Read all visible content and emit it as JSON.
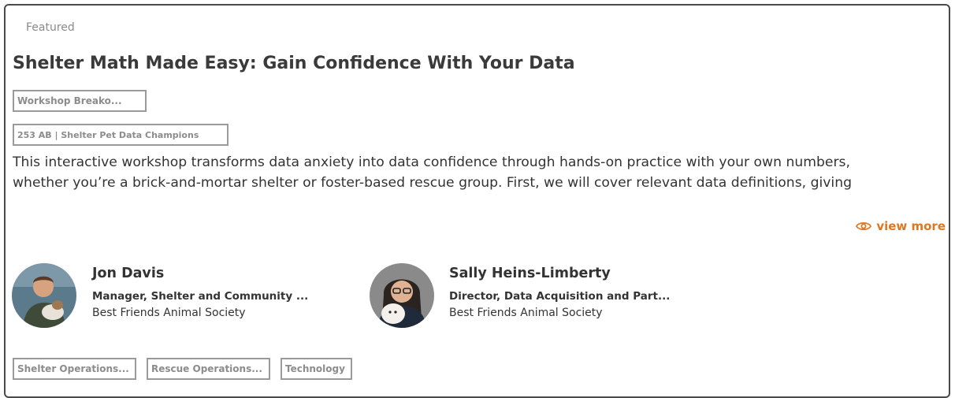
{
  "session": {
    "featured_label": "Featured",
    "title": "Shelter Math Made Easy: Gain Confidence With Your Data",
    "type_tag": "Workshop Breako...",
    "room_tag": "253 AB | Shelter Pet Data Champions",
    "description_lines": [
      "This interactive workshop transforms data anxiety into data confidence through hands-on practice with your own numbers,",
      "whether you’re a brick-and-mortar shelter or foster-based rescue group. First, we will cover relevant data definitions, giving"
    ],
    "view_more_label": "view more"
  },
  "speakers": [
    {
      "name": "Jon Davis",
      "role": "Manager, Shelter and Community ...",
      "organization": "Best Friends Animal Society"
    },
    {
      "name": "Sally Heins-Limberty",
      "role": "Director, Data Acquisition and Part...",
      "organization": "Best Friends Animal Society"
    }
  ],
  "tracks": [
    "Shelter Operations...",
    "Rescue Operations...",
    "Technology"
  ],
  "colors": {
    "accent": "#e07620",
    "border": "#4a4a4a",
    "tag_border": "#9a9a9a",
    "tag_text": "#8c8c8c"
  }
}
